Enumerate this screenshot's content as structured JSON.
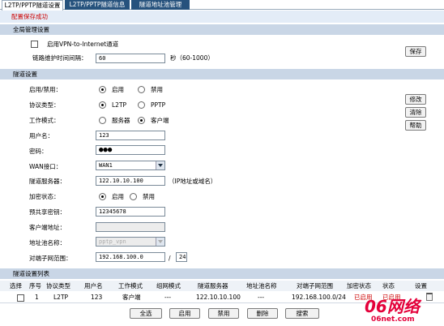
{
  "tabs": [
    {
      "label": "L2TP/PPTP隧道设置",
      "active": true
    },
    {
      "label": "L2TP/PPTP隧道信息",
      "active": false
    },
    {
      "label": "隧道地址池管理",
      "active": false
    }
  ],
  "status_message": "配置保存成功",
  "global": {
    "title": "全局管理设置",
    "enable_vpn_label": "启用VPN-to-Internet通道",
    "enable_vpn_checked": false,
    "keepalive_label": "链路维护时间间隔：",
    "keepalive_value": "60",
    "keepalive_unit": "秒（60-1000）",
    "save_button": "保存"
  },
  "tunnel": {
    "title": "隧道设置",
    "enable_label": "启用/禁用：",
    "enable_on": "启用",
    "enable_off": "禁用",
    "protocol_label": "协议类型：",
    "protocol_l2tp": "L2TP",
    "protocol_pptp": "PPTP",
    "mode_label": "工作模式：",
    "mode_server": "服务器",
    "mode_client": "客户端",
    "username_label": "用户名：",
    "username_value": "123",
    "password_label": "密码：",
    "password_value": "●●●",
    "wan_label": "WAN接口：",
    "wan_value": "WAN1",
    "server_label": "隧道服务器：",
    "server_value": "122.10.10.100",
    "server_hint": "（IP地址或域名）",
    "encrypt_label": "加密状态：",
    "encrypt_on": "启用",
    "encrypt_off": "禁用",
    "psk_label": "预共享密钥：",
    "psk_value": "12345678",
    "client_addr_label": "客户端地址：",
    "client_addr_value": "",
    "pool_label": "地址池名称：",
    "pool_value": "pptp_vpn",
    "peer_range_label": "对端子网范围：",
    "peer_ip_value": "192.168.100.0",
    "peer_mask_sep": "/",
    "peer_mask_value": "24",
    "modify_button": "修改",
    "clear_button": "清除",
    "help_button": "帮助"
  },
  "list": {
    "title": "隧道设置列表",
    "columns": [
      "选择",
      "序号",
      "协议类型",
      "用户名",
      "工作模式",
      "组网模式",
      "隧道服务器",
      "地址池名称",
      "对端子网范围",
      "加密状态",
      "状态",
      "设置"
    ],
    "rows": [
      {
        "select": false,
        "index": "1",
        "protocol": "L2TP",
        "username": "123",
        "mode": "客户端",
        "net_mode": "---",
        "server": "122.10.10.100",
        "pool": "---",
        "peer_range": "192.168.100.0/24",
        "encrypt": "已启用",
        "status": "已启用"
      }
    ],
    "buttons": {
      "select_all": "全选",
      "enable": "启用",
      "disable": "禁用",
      "delete": "删除",
      "search": "搜索"
    }
  },
  "watermark": {
    "main": "06网络",
    "sub": "06net.com"
  }
}
